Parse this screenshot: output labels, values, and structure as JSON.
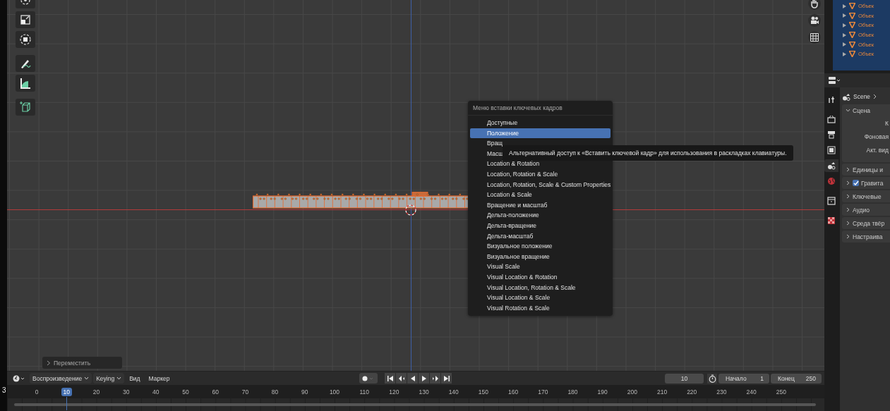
{
  "viewport": {
    "tools": [
      {
        "kind": "rotate"
      },
      {
        "kind": "scale"
      },
      {
        "kind": "transform"
      },
      {
        "kind": "annotate"
      },
      {
        "kind": "measure"
      },
      {
        "kind": "add_cube"
      }
    ],
    "gizmos": [
      {
        "kind": "hand"
      },
      {
        "kind": "camera"
      },
      {
        "kind": "grid"
      }
    ],
    "menu": {
      "title": "Меню вставки ключевых кадров",
      "items": [
        {
          "label": "Доступные",
          "selected": false
        },
        {
          "label": "Положение",
          "selected": true
        },
        {
          "label": "Вращ",
          "selected": false
        },
        {
          "label": "Масш",
          "selected": false
        },
        {
          "label": "Location & Rotation",
          "selected": false
        },
        {
          "label": "Location, Rotation & Scale",
          "selected": false
        },
        {
          "label": "Location, Rotation, Scale & Custom Properties",
          "selected": false
        },
        {
          "label": "Location & Scale",
          "selected": false
        },
        {
          "label": "Вращение и масштаб",
          "selected": false
        },
        {
          "label": "Дельта-положение",
          "selected": false
        },
        {
          "label": "Дельта-вращение",
          "selected": false
        },
        {
          "label": "Дельта-масштаб",
          "selected": false
        },
        {
          "label": "Визуальное положение",
          "selected": false
        },
        {
          "label": "Визуальное вращение",
          "selected": false
        },
        {
          "label": "Visual Scale",
          "selected": false
        },
        {
          "label": "Visual Location & Rotation",
          "selected": false
        },
        {
          "label": "Visual Location, Rotation & Scale",
          "selected": false
        },
        {
          "label": "Visual Location & Scale",
          "selected": false
        },
        {
          "label": "Visual Rotation & Scale",
          "selected": false
        }
      ]
    },
    "tooltip": "Альтернативный доступ к «Вставить ключевой кадр» для использования в раскладках клавиатуры.",
    "last_operator": "Переместить"
  },
  "outliner": {
    "rows": [
      {
        "label": "Объек"
      },
      {
        "label": "Объек"
      },
      {
        "label": "Объек"
      },
      {
        "label": "Объек"
      },
      {
        "label": "Объек"
      },
      {
        "label": "Объек"
      }
    ]
  },
  "properties": {
    "tabs": [
      {
        "kind": "tool",
        "selected": false
      },
      {
        "kind": "render",
        "selected": false
      },
      {
        "kind": "output",
        "selected": false
      },
      {
        "kind": "view_layer",
        "selected": false
      },
      {
        "kind": "scene",
        "selected": true
      },
      {
        "kind": "world",
        "selected": false
      },
      {
        "kind": "collection",
        "selected": false
      },
      {
        "kind": "texture",
        "selected": false
      }
    ],
    "breadcrumb": "Scene",
    "sections": [
      {
        "label": "Сцена",
        "expanded": true,
        "fields": [
          "К",
          "Фоновая",
          "Акт. вид"
        ]
      },
      {
        "label": "Единицы и",
        "expanded": false
      },
      {
        "label": "Гравита",
        "expanded": false,
        "checked": true
      },
      {
        "label": "Ключевые",
        "expanded": false
      },
      {
        "label": "Аудио",
        "expanded": false
      },
      {
        "label": "Среда твёр",
        "expanded": false
      },
      {
        "label": "Настраива",
        "expanded": false
      }
    ]
  },
  "timeline": {
    "edge_label": "3",
    "menus": [
      {
        "label": "Воспроизведение",
        "kind": "dropdown"
      },
      {
        "label": "Keying",
        "kind": "dropdown"
      },
      {
        "label": "Вид",
        "kind": "menu"
      },
      {
        "label": "Маркер",
        "kind": "menu"
      }
    ],
    "current_frame": "10",
    "start_label": "Начало",
    "start": "1",
    "end_label": "Конец",
    "end": "250",
    "ruler": [
      {
        "label": "0",
        "selected": false
      },
      {
        "label": "10",
        "selected": true
      },
      {
        "label": "20",
        "selected": false
      },
      {
        "label": "30",
        "selected": false
      },
      {
        "label": "40",
        "selected": false
      },
      {
        "label": "50",
        "selected": false
      },
      {
        "label": "60",
        "selected": false
      },
      {
        "label": "70",
        "selected": false
      },
      {
        "label": "80",
        "selected": false
      },
      {
        "label": "90",
        "selected": false
      },
      {
        "label": "100",
        "selected": false
      },
      {
        "label": "110",
        "selected": false
      },
      {
        "label": "120",
        "selected": false
      },
      {
        "label": "130",
        "selected": false
      },
      {
        "label": "140",
        "selected": false
      },
      {
        "label": "150",
        "selected": false
      },
      {
        "label": "160",
        "selected": false
      },
      {
        "label": "170",
        "selected": false
      },
      {
        "label": "180",
        "selected": false
      },
      {
        "label": "190",
        "selected": false
      },
      {
        "label": "200",
        "selected": false
      },
      {
        "label": "210",
        "selected": false
      },
      {
        "label": "220",
        "selected": false
      },
      {
        "label": "230",
        "selected": false
      },
      {
        "label": "240",
        "selected": false
      },
      {
        "label": "250",
        "selected": false
      }
    ]
  }
}
